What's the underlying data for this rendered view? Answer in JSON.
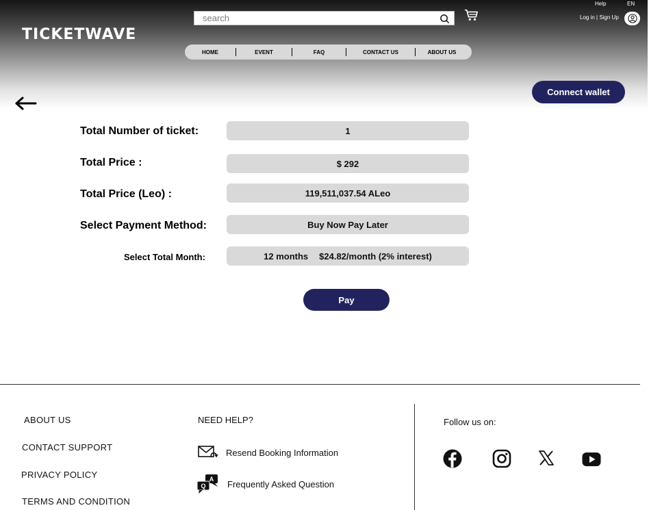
{
  "header": {
    "logo": "TICKETWAVE",
    "search_placeholder": "search",
    "help": "Help",
    "lang": "EN",
    "auth": "Log in | Sign Up",
    "nav": [
      "HOME",
      "EVENT",
      "FAQ",
      "CONTACT US",
      "ABOUT US"
    ]
  },
  "connect_wallet": "Connect wallet",
  "form": {
    "tickets_label": "Total Number of ticket:",
    "tickets_value": "1",
    "price_label": "Total Price :",
    "price_value": "$ 292",
    "price_leo_label": "Total Price (Leo) :",
    "price_leo_value": "119,511,037.54 ALeo",
    "payment_label": "Select Payment Method:",
    "payment_value": "Buy Now Pay Later",
    "month_label": "Select Total Month:",
    "month_count": "12 months",
    "month_rate": "$24.82/month (2% interest)"
  },
  "pay_button": "Pay",
  "footer": {
    "links": [
      "ABOUT US",
      "CONTACT SUPPORT",
      "PRIVACY POLICY",
      "TERMS AND CONDITION"
    ],
    "need_help": "NEED HELP?",
    "resend": "Resend Booking Information",
    "faq": "Frequently Asked Question",
    "follow": "Follow us on:"
  },
  "icons": {
    "social": [
      "facebook-icon",
      "instagram-icon",
      "x-icon",
      "youtube-icon"
    ]
  },
  "colors": {
    "accent": "#22235e",
    "field": "#d9d9d9"
  }
}
